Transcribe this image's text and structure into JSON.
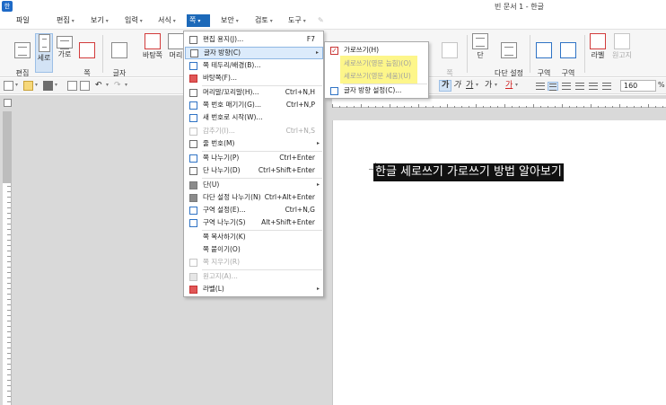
{
  "app": {
    "title": "빈 문서 1 - 한글",
    "logo": "한"
  },
  "menubar": {
    "file": "파일",
    "edit": "편집",
    "view": "보기",
    "insert": "입력",
    "format": "서식",
    "page": "쪽",
    "security": "보안",
    "review": "검토",
    "tools": "도구"
  },
  "ribbon": {
    "edit_paper": "편집\n용지",
    "portrait": "세로",
    "landscape": "가로",
    "page_margin": "쪽\n여백",
    "text_dir": "글자\n방향",
    "background": "바탕쪽",
    "header": "머리",
    "delete": "쪽\n지우기",
    "column": "단",
    "multi_column": "다단 설정\n나누기",
    "section_settings": "구역\n설정",
    "section_break": "구역\n나누기",
    "label": "라벨",
    "manuscript": "원고지"
  },
  "toolbar": {
    "bold": "가",
    "italic": "가",
    "underline": "가",
    "strike": "가",
    "color": "가",
    "zoom": "160",
    "zoom_unit": "%"
  },
  "page_menu": {
    "items": [
      {
        "label": "편집 용지(J)...",
        "key": "F7",
        "icon": "page-setup-icon"
      },
      {
        "label": "글자 방향(C)",
        "key": "",
        "icon": "text-direction-icon",
        "submenu": true
      },
      {
        "label": "쪽 테두리/배경(B)...",
        "key": "",
        "icon": "page-border-icon"
      },
      {
        "label": "바탕쪽(F)...",
        "key": "",
        "icon": "master-page-icon"
      },
      {
        "label": "머리말/꼬리말(H)...",
        "key": "Ctrl+N,H",
        "icon": "header-footer-icon"
      },
      {
        "label": "쪽 번호 매기기(G)...",
        "key": "Ctrl+N,P",
        "icon": "page-number-icon"
      },
      {
        "label": "새 번호로 시작(W)...",
        "key": "",
        "icon": "new-number-icon"
      },
      {
        "label": "감추기(I)...",
        "key": "Ctrl+N,S",
        "icon": "hide-icon",
        "disabled": true
      },
      {
        "label": "줄 번호(M)",
        "key": "",
        "icon": "line-number-icon",
        "submenu": true
      },
      {
        "label": "쪽 나누기(P)",
        "key": "Ctrl+Enter",
        "icon": "page-break-icon"
      },
      {
        "label": "단 나누기(D)",
        "key": "Ctrl+Shift+Enter",
        "icon": "column-break-icon"
      },
      {
        "label": "단(U)",
        "key": "",
        "icon": "column-icon",
        "submenu": true
      },
      {
        "label": "다단 설정 나누기(N)",
        "key": "Ctrl+Alt+Enter",
        "icon": "multi-column-break-icon"
      },
      {
        "label": "구역 설정(E)...",
        "key": "Ctrl+N,G",
        "icon": "section-settings-icon"
      },
      {
        "label": "구역 나누기(S)",
        "key": "Alt+Shift+Enter",
        "icon": "section-break-icon"
      },
      {
        "label": "쪽 복사하기(K)",
        "key": "",
        "icon": ""
      },
      {
        "label": "쪽 붙이기(O)",
        "key": "",
        "icon": ""
      },
      {
        "label": "쪽 지우기(R)",
        "key": "",
        "icon": "delete-page-icon",
        "disabled": true
      },
      {
        "label": "원고지(A)...",
        "key": "",
        "icon": "manuscript-icon",
        "disabled": true
      },
      {
        "label": "라벨(L)",
        "key": "",
        "icon": "label-icon",
        "submenu": true
      }
    ]
  },
  "text_direction_submenu": {
    "horizontal": "가로쓰기(H)",
    "vertical_lying": "세로쓰기(영문 눕힘)(O)",
    "vertical_upright": "세로쓰기(영문 세움)(U)",
    "settings": "글자 방향 설정(C)..."
  },
  "document": {
    "text": "한글 세로쓰기 가로쓰기 방법 알아보기"
  },
  "colors": {
    "menu_active": "#1c69b9",
    "highlight_yellow": "#fdf68a",
    "selection_blue": "#dcebfb"
  }
}
